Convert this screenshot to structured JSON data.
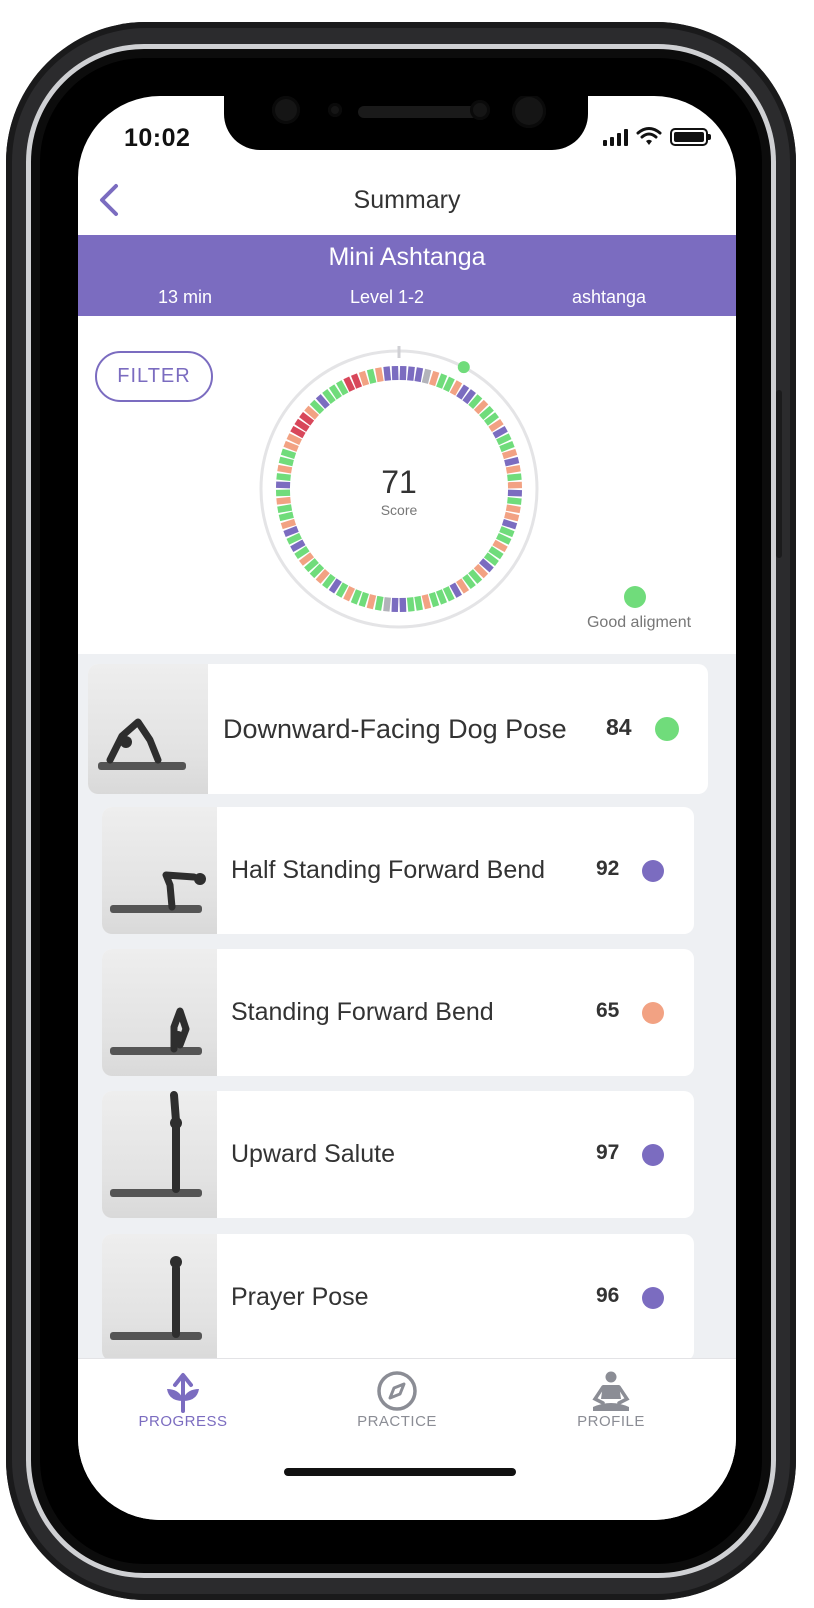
{
  "status_bar": {
    "time": "10:02"
  },
  "nav": {
    "title": "Summary"
  },
  "session": {
    "title": "Mini Ashtanga",
    "duration": "13 min",
    "level": "Level 1-2",
    "style": "ashtanga"
  },
  "filter_label": "FILTER",
  "score": {
    "value": "71",
    "label": "Score"
  },
  "legend": {
    "label": "Good aligment",
    "color": "#70dc7b"
  },
  "colors": {
    "accent": "#7b6cc0",
    "good": "#70dc7b",
    "purple": "#7b6cc0",
    "salmon": "#f2a283",
    "red": "#d8475a",
    "gray": "#b2b3ba"
  },
  "poses": [
    {
      "name": "Downward-Facing Dog Pose",
      "score": "84",
      "status_color": "#70dc7b"
    },
    {
      "name": "Half Standing Forward Bend",
      "score": "92",
      "status_color": "#7b6cc0"
    },
    {
      "name": "Standing Forward Bend",
      "score": "65",
      "status_color": "#f2a283"
    },
    {
      "name": "Upward Salute",
      "score": "97",
      "status_color": "#7b6cc0"
    },
    {
      "name": "Prayer Pose",
      "score": "96",
      "status_color": "#7b6cc0"
    }
  ],
  "tabs": [
    {
      "label": "PROGRESS",
      "icon": "sprout-icon",
      "active": true
    },
    {
      "label": "PRACTICE",
      "icon": "compass-icon",
      "active": false
    },
    {
      "label": "PROFILE",
      "icon": "meditation-icon",
      "active": false
    }
  ]
}
